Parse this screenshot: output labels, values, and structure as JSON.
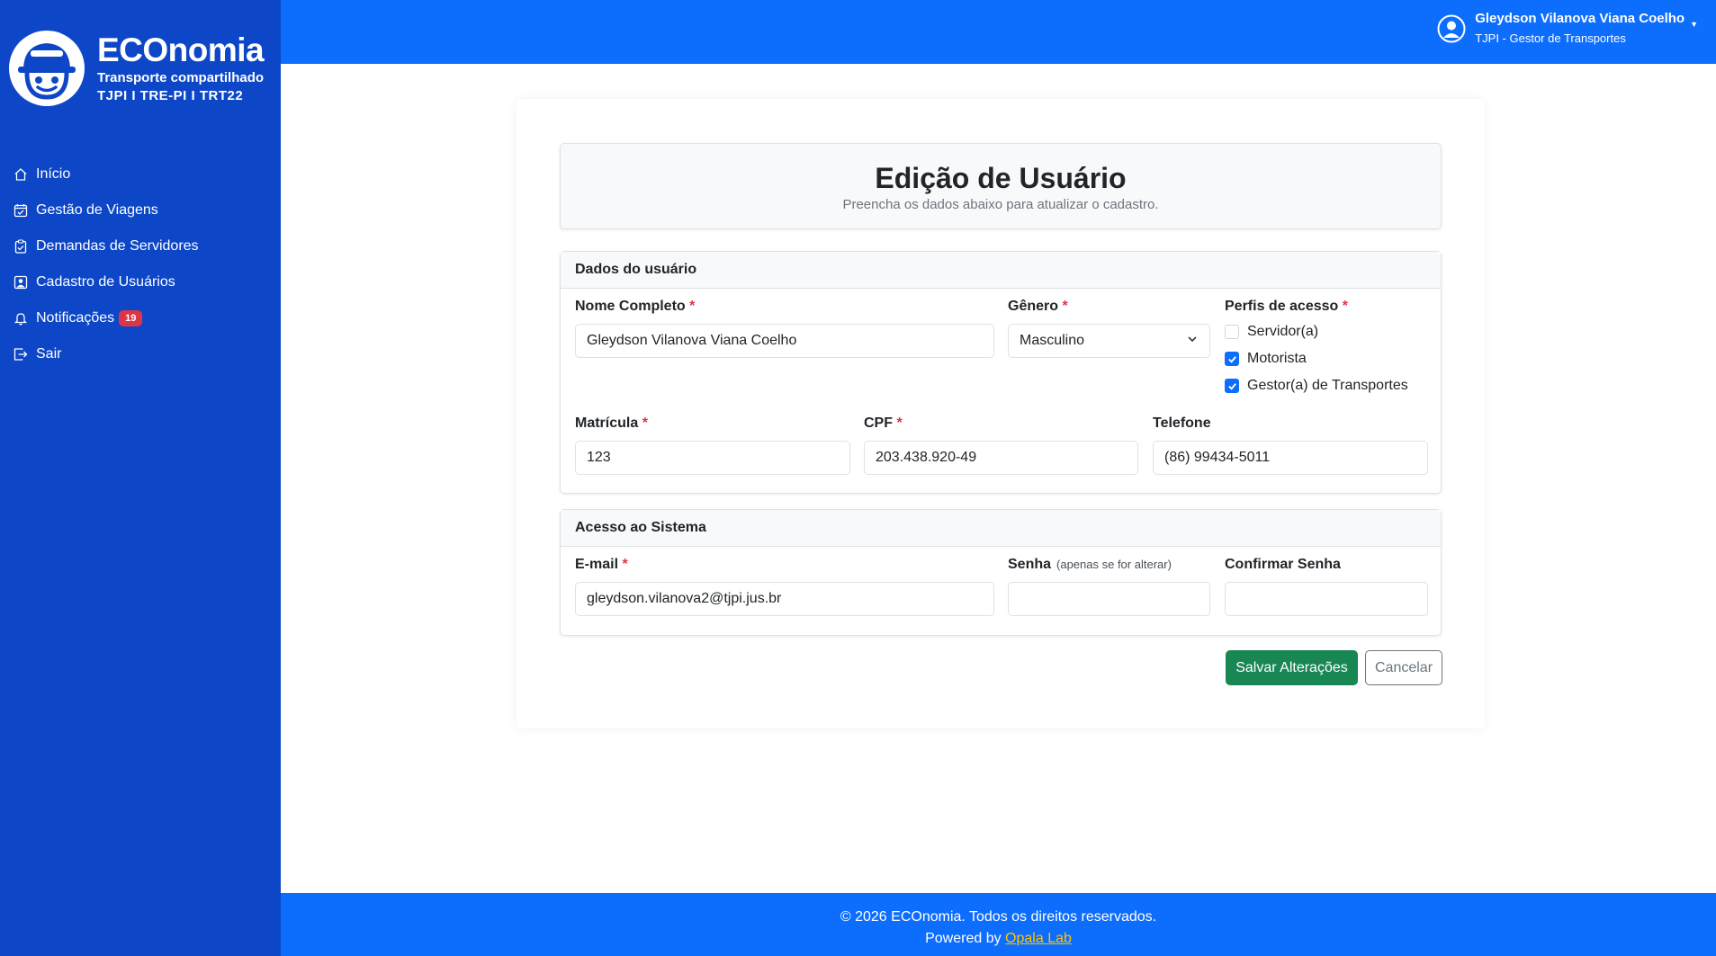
{
  "brand": {
    "title": "ECOnomia",
    "subtitle": "Transporte compartilhado",
    "orgs": "TJPI I TRE-PI I TRT22"
  },
  "sidebar": {
    "items": [
      {
        "label": "Início",
        "icon": "home-icon"
      },
      {
        "label": "Gestão de Viagens",
        "icon": "calendar-check-icon"
      },
      {
        "label": "Demandas de Servidores",
        "icon": "clipboard-check-icon"
      },
      {
        "label": "Cadastro de Usuários",
        "icon": "person-badge-icon"
      },
      {
        "label": "Notificações",
        "icon": "bell-icon",
        "badge": "19"
      },
      {
        "label": "Sair",
        "icon": "logout-icon"
      }
    ]
  },
  "header": {
    "user_name": "Gleydson Vilanova Viana Coelho",
    "user_role": "TJPI - Gestor de Transportes"
  },
  "page": {
    "title": "Edição de Usuário",
    "subtitle": "Preencha os dados abaixo para atualizar o cadastro."
  },
  "user_section": {
    "title": "Dados do usuário",
    "name_label": "Nome Completo",
    "name_value": "Gleydson Vilanova Viana Coelho",
    "gender_label": "Gênero",
    "gender_value": "Masculino",
    "profiles_label": "Perfis de acesso",
    "profiles": [
      {
        "label": "Servidor(a)",
        "checked": false
      },
      {
        "label": "Motorista",
        "checked": true
      },
      {
        "label": "Gestor(a) de Transportes",
        "checked": true
      }
    ],
    "registration_label": "Matrícula",
    "registration_value": "123",
    "cpf_label": "CPF",
    "cpf_value": "203.438.920-49",
    "phone_label": "Telefone",
    "phone_value": "(86) 99434-5011"
  },
  "access_section": {
    "title": "Acesso ao Sistema",
    "email_label": "E-mail",
    "email_value": "gleydson.vilanova2@tjpi.jus.br",
    "password_label": "Senha",
    "password_hint": "(apenas se for alterar)",
    "confirm_label": "Confirmar Senha"
  },
  "actions": {
    "save_label": "Salvar Alterações",
    "cancel_label": "Cancelar"
  },
  "footer": {
    "copyright": "© 2026 ECOnomia. Todos os direitos reservados.",
    "powered_prefix": "Powered by",
    "powered_link": "Opala Lab"
  },
  "colors": {
    "sidebar": "#0d47c7",
    "primary": "#0d6efd",
    "success": "#198754",
    "danger": "#dc3545",
    "link": "#ffc107"
  }
}
